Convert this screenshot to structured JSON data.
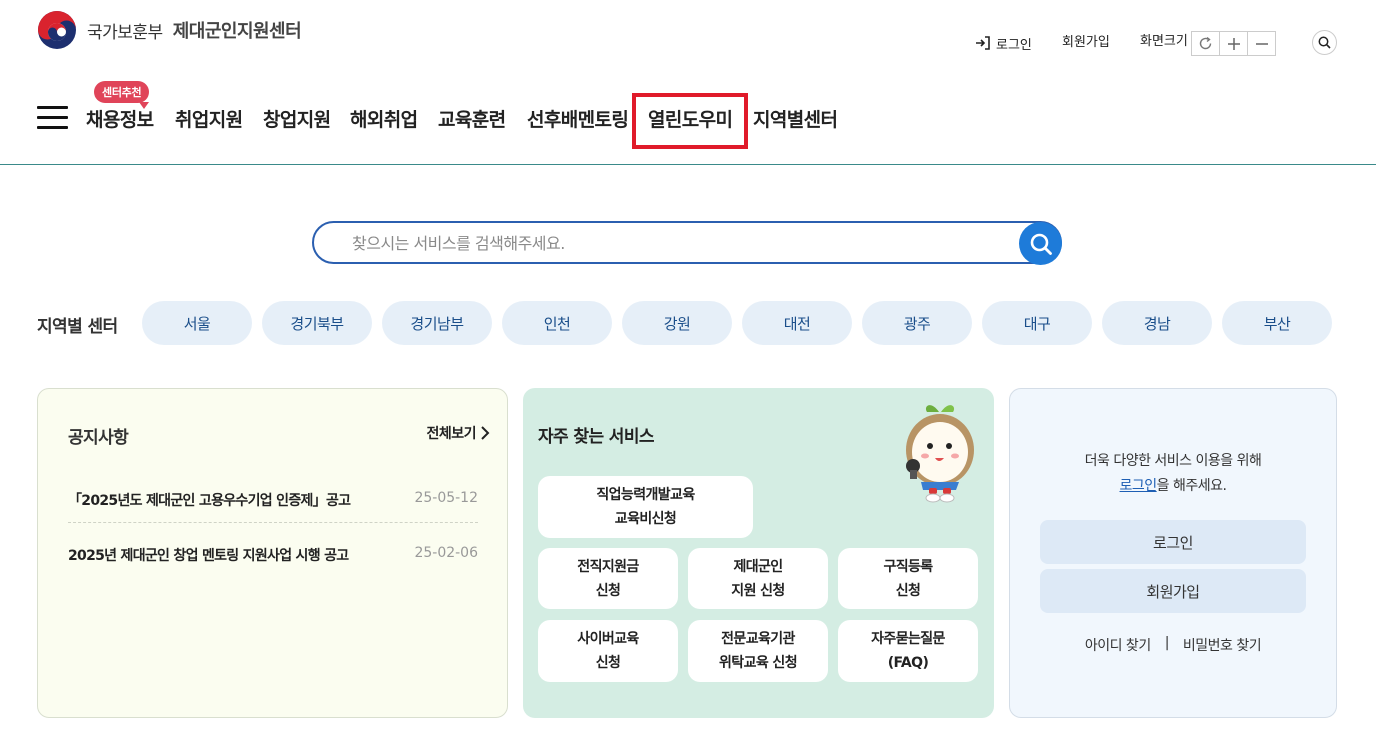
{
  "header": {
    "org_name": "국가보훈부",
    "center_name": "제대군인지원센터",
    "util": {
      "login": "로그인",
      "join": "회원가입",
      "zoom_label": "화면크기"
    }
  },
  "gnb": {
    "badge": "센터추천",
    "items": [
      "채용정보",
      "취업지원",
      "창업지원",
      "해외취업",
      "교육훈련",
      "선후배멘토링",
      "열린도우미",
      "지역별센터"
    ]
  },
  "search": {
    "placeholder": "찾으시는 서비스를 검색해주세요."
  },
  "regions": {
    "label": "지역별 센터",
    "items": [
      "서울",
      "경기북부",
      "경기남부",
      "인천",
      "강원",
      "대전",
      "광주",
      "대구",
      "경남",
      "부산"
    ]
  },
  "notice": {
    "title": "공지사항",
    "more": "전체보기",
    "items": [
      {
        "title": "「2025년도 제대군인 고용우수기업 인증제」공고",
        "date": "25-05-12"
      },
      {
        "title": "2025년 제대군인 창업 멘토링 지원사업 시행 공고",
        "date": "25-02-06"
      }
    ]
  },
  "services": {
    "title": "자주 찾는 서비스",
    "items": [
      {
        "line1": "직업능력개발교육",
        "line2": "교육비신청"
      },
      {
        "line1": "전직지원금",
        "line2": "신청"
      },
      {
        "line1": "제대군인",
        "line2": "지원 신청"
      },
      {
        "line1": "구직등록",
        "line2": "신청"
      },
      {
        "line1": "사이버교육",
        "line2": "신청"
      },
      {
        "line1": "전문교육기관",
        "line2": "위탁교육 신청"
      },
      {
        "line1": "자주묻는질문",
        "line2": "(FAQ)"
      }
    ]
  },
  "member": {
    "msg_line1": "더욱 다양한 서비스 이용을 위해",
    "msg_link": "로그인",
    "msg_rest": "을 해주세요.",
    "login_button": "로그인",
    "join_button": "회원가입",
    "find_id": "아이디 찾기",
    "separator": "|",
    "find_pw": "비밀번호 찾기"
  },
  "colors": {
    "accent_blue": "#1e7bd9",
    "highlight_red": "#e01a2a",
    "badge_red": "#e04459",
    "services_bg": "#d4ede3"
  }
}
